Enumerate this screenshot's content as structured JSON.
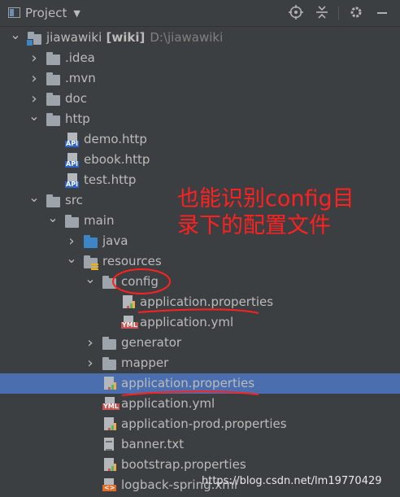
{
  "toolbar": {
    "title": "Project",
    "icons": [
      "locate-icon",
      "collapse-icon",
      "settings-icon",
      "minimize-icon"
    ]
  },
  "tree": [
    {
      "name": "jiawawiki",
      "suffix": "[wiki]",
      "path": "D:\\jiawawiki",
      "type": "module",
      "depth": 0,
      "arrow": "down"
    },
    {
      "name": ".idea",
      "type": "folder",
      "depth": 1,
      "arrow": "right"
    },
    {
      "name": ".mvn",
      "type": "folder",
      "depth": 1,
      "arrow": "right"
    },
    {
      "name": "doc",
      "type": "folder",
      "depth": 1,
      "arrow": "right"
    },
    {
      "name": "http",
      "type": "folder",
      "depth": 1,
      "arrow": "down"
    },
    {
      "name": "demo.http",
      "type": "api",
      "depth": 2
    },
    {
      "name": "ebook.http",
      "type": "api",
      "depth": 2
    },
    {
      "name": "test.http",
      "type": "api",
      "depth": 2
    },
    {
      "name": "src",
      "type": "folder",
      "depth": 1,
      "arrow": "down"
    },
    {
      "name": "main",
      "type": "folder",
      "depth": 2,
      "arrow": "down"
    },
    {
      "name": "java",
      "type": "folder-blue",
      "depth": 3,
      "arrow": "right"
    },
    {
      "name": "resources",
      "type": "resources",
      "depth": 3,
      "arrow": "down"
    },
    {
      "name": "config",
      "type": "folder",
      "depth": 4,
      "arrow": "down"
    },
    {
      "name": "application.properties",
      "type": "properties",
      "depth": 5
    },
    {
      "name": "application.yml",
      "type": "yml",
      "depth": 5
    },
    {
      "name": "generator",
      "type": "folder",
      "depth": 4,
      "arrow": "right"
    },
    {
      "name": "mapper",
      "type": "folder",
      "depth": 4,
      "arrow": "right"
    },
    {
      "name": "application.properties",
      "type": "properties",
      "depth": 4,
      "selected": true
    },
    {
      "name": "application.yml",
      "type": "yml",
      "depth": 4
    },
    {
      "name": "application-prod.properties",
      "type": "properties",
      "depth": 4
    },
    {
      "name": "banner.txt",
      "type": "txt",
      "depth": 4
    },
    {
      "name": "bootstrap.properties",
      "type": "properties",
      "depth": 4
    },
    {
      "name": "logback-spring.xml",
      "type": "xml",
      "depth": 4
    }
  ],
  "icon_tags": {
    "api": "API",
    "yml": "YML",
    "xml": "<>"
  },
  "annotation": {
    "text": "也能识别config目录下的配置文件",
    "color": "#ff2020"
  },
  "watermark": "https://blog.csdn.net/lm19770429",
  "colors": {
    "background": "#3c3f41",
    "selection": "#4b6eaf",
    "text": "#bbbbbb",
    "annotation_red": "#ff2020"
  }
}
